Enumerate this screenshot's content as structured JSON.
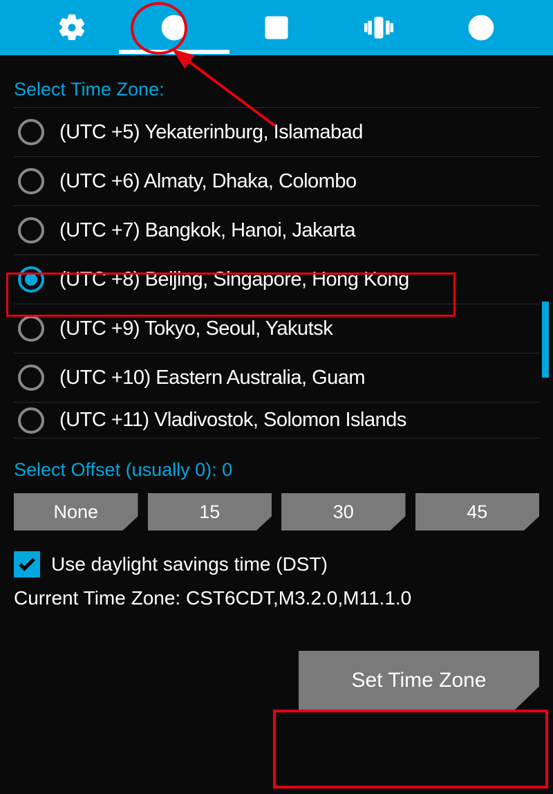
{
  "tabs": [
    {
      "name": "settings-gear-icon"
    },
    {
      "name": "clock-icon",
      "active": true
    },
    {
      "name": "brightness-icon"
    },
    {
      "name": "vibration-icon"
    },
    {
      "name": "globe-icon"
    }
  ],
  "select_tz_label": "Select Time Zone:",
  "timezones": [
    {
      "label": "(UTC +5) Yekaterinburg, Islamabad",
      "selected": false
    },
    {
      "label": "(UTC +6) Almaty, Dhaka, Colombo",
      "selected": false
    },
    {
      "label": "(UTC +7) Bangkok, Hanoi, Jakarta",
      "selected": false
    },
    {
      "label": "(UTC +8) Beijing, Singapore, Hong Kong",
      "selected": true
    },
    {
      "label": "(UTC +9) Tokyo, Seoul, Yakutsk",
      "selected": false
    },
    {
      "label": "(UTC +10) Eastern Australia, Guam",
      "selected": false
    },
    {
      "label": "(UTC +11) Vladivostok, Solomon Islands",
      "selected": false
    }
  ],
  "offset": {
    "label": "Select Offset (usually 0): 0",
    "options": [
      "None",
      "15",
      "30",
      "45"
    ]
  },
  "dst": {
    "checked": true,
    "label": "Use daylight savings time (DST)"
  },
  "current_tz": "Current Time Zone: CST6CDT,M3.2.0,M11.1.0",
  "set_btn": "Set Time Zone"
}
